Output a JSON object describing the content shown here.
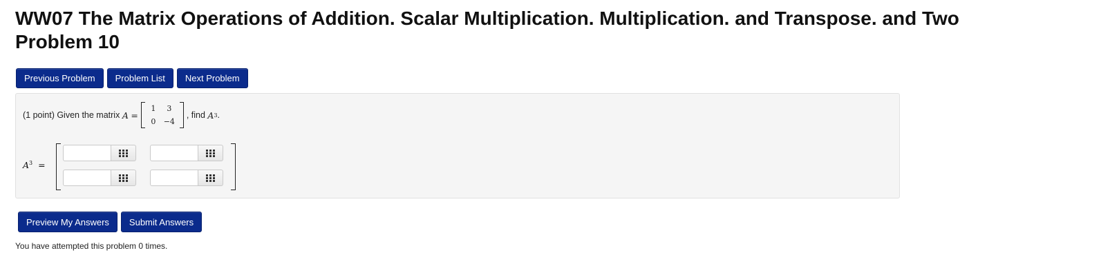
{
  "page": {
    "title_line1": "WW07 The Matrix Operations of Addition. Scalar Multiplication. Multiplication. and Transpose. and Two",
    "title_line2": "Problem 10"
  },
  "nav": {
    "previous": "Previous Problem",
    "list": "Problem List",
    "next": "Next Problem"
  },
  "problem": {
    "intro": "(1 point) Given the matrix",
    "matrix_name": "A",
    "equals": "=",
    "matrix": [
      [
        "1",
        "3"
      ],
      [
        "0",
        "−4"
      ]
    ],
    "find_text": ", find",
    "find_name": "A",
    "find_exp": "3",
    "find_end": "."
  },
  "answer": {
    "label_name": "A",
    "label_exp": "3",
    "label_eq": "=",
    "cells": [
      {
        "value": "",
        "icon": "matrix-grid-icon"
      },
      {
        "value": "",
        "icon": "matrix-grid-icon"
      },
      {
        "value": "",
        "icon": "matrix-grid-icon"
      },
      {
        "value": "",
        "icon": "matrix-grid-icon"
      }
    ]
  },
  "actions": {
    "preview": "Preview My Answers",
    "submit": "Submit Answers"
  },
  "status": {
    "attempts": "You have attempted this problem 0 times."
  },
  "colors": {
    "button_bg": "#0b2b8c",
    "box_bg": "#f5f5f5"
  }
}
